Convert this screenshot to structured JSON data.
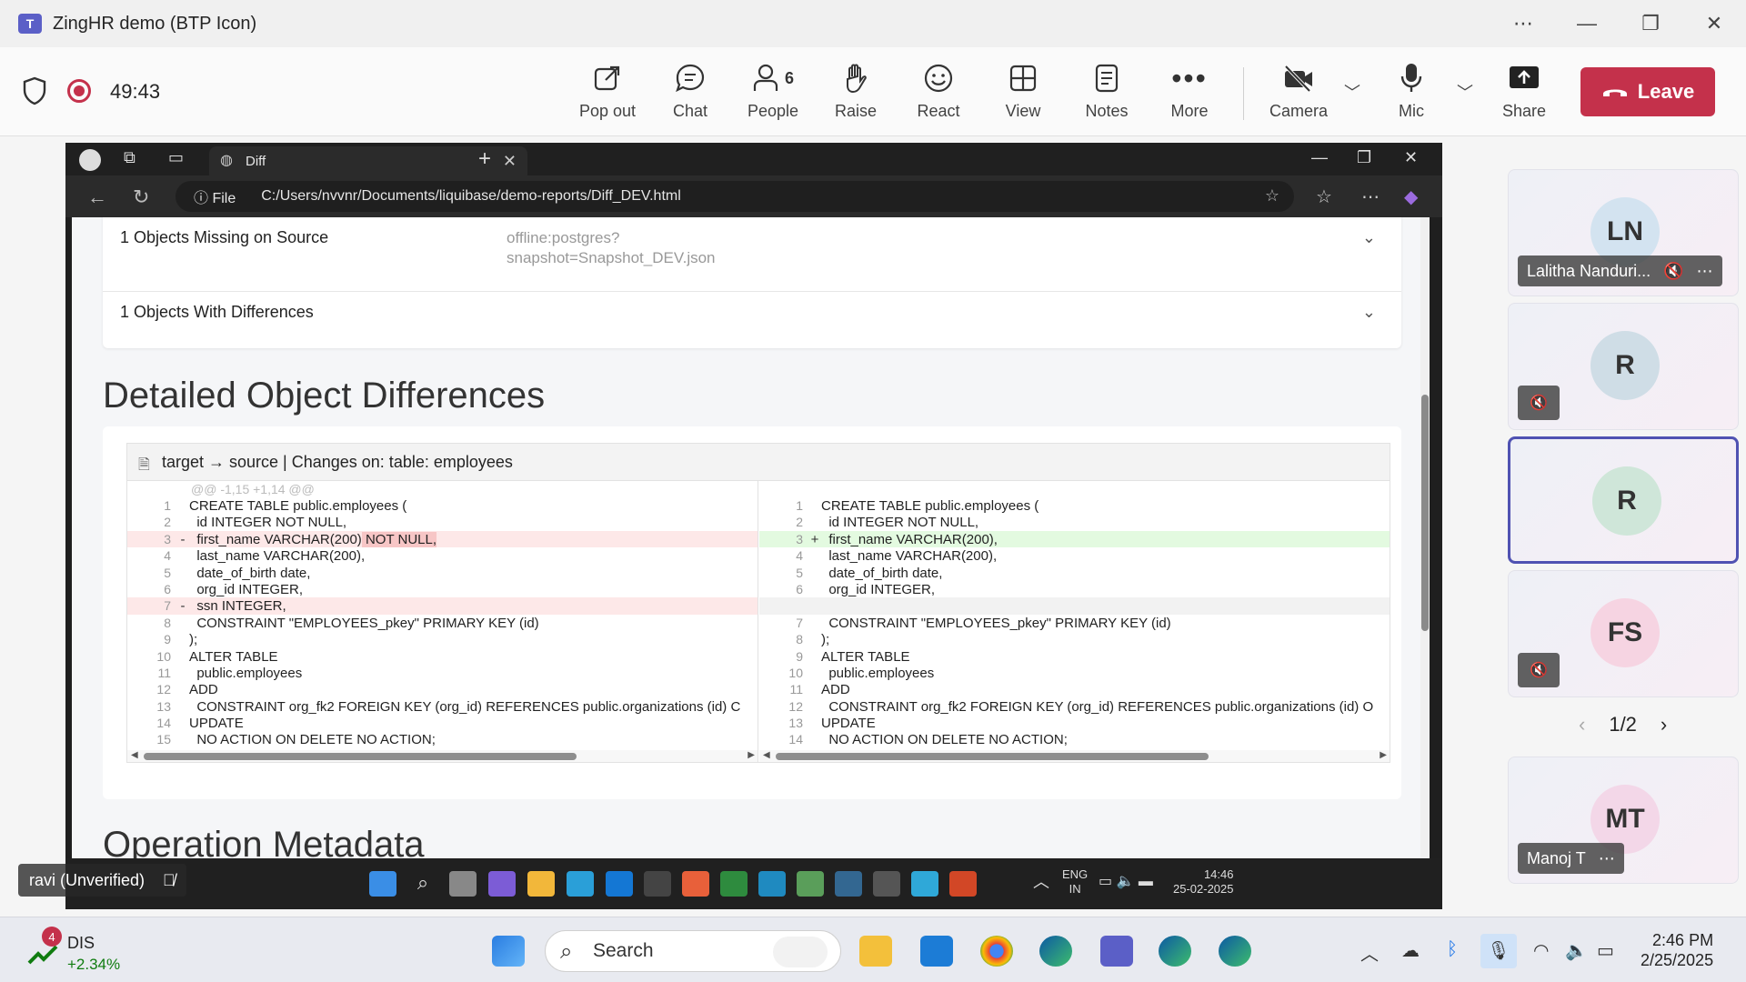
{
  "window": {
    "title": "ZingHR demo (BTP Icon)"
  },
  "meeting": {
    "timer": "49:43",
    "buttons": [
      {
        "label": "Pop out",
        "icon": "pop-out-icon"
      },
      {
        "label": "Chat",
        "icon": "chat-icon"
      },
      {
        "label": "People",
        "icon": "people-icon",
        "count": "6"
      },
      {
        "label": "Raise",
        "icon": "raise-hand-icon"
      },
      {
        "label": "React",
        "icon": "react-icon"
      },
      {
        "label": "View",
        "icon": "view-icon"
      },
      {
        "label": "Notes",
        "icon": "notes-icon"
      },
      {
        "label": "More",
        "icon": "more-icon"
      }
    ],
    "camera_label": "Camera",
    "mic_label": "Mic",
    "share_label": "Share",
    "leave_label": "Leave",
    "leave_color": "#c4314b"
  },
  "browser": {
    "tab_title": "Diff",
    "address_prefix": "File",
    "url": "C:/Users/nvvnr/Documents/liquibase/demo-reports/Diff_DEV.html"
  },
  "report": {
    "missing_on_source": "1 Objects Missing on Source",
    "offline_info_1": "offline:postgres?",
    "offline_info_2": "snapshot=Snapshot_DEV.json",
    "with_differences": "1 Objects With Differences",
    "detailed_title": "Detailed Object Differences",
    "diff_header": "target → source | Changes on: table: employees",
    "hunk": "@@ -1,15 +1,14 @@",
    "left_lines": [
      {
        "n": "1",
        "m": "",
        "t": "CREATE TABLE public.employees (",
        "type": "ctx"
      },
      {
        "n": "2",
        "m": "",
        "t": "  id INTEGER NOT NULL,",
        "type": "ctx"
      },
      {
        "n": "3",
        "m": "-",
        "t": "  first_name VARCHAR(200)",
        "hl": " NOT NULL,",
        "type": "del"
      },
      {
        "n": "4",
        "m": "",
        "t": "  last_name VARCHAR(200),",
        "type": "ctx"
      },
      {
        "n": "5",
        "m": "",
        "t": "  date_of_birth date,",
        "type": "ctx"
      },
      {
        "n": "6",
        "m": "",
        "t": "  org_id INTEGER,",
        "type": "ctx"
      },
      {
        "n": "7",
        "m": "-",
        "t": "  ssn INTEGER,",
        "type": "del"
      },
      {
        "n": "8",
        "m": "",
        "t": "  CONSTRAINT \"EMPLOYEES_pkey\" PRIMARY KEY (id)",
        "type": "ctx"
      },
      {
        "n": "9",
        "m": "",
        "t": ");",
        "type": "ctx"
      },
      {
        "n": "10",
        "m": "",
        "t": "ALTER TABLE",
        "type": "ctx"
      },
      {
        "n": "11",
        "m": "",
        "t": "  public.employees",
        "type": "ctx"
      },
      {
        "n": "12",
        "m": "",
        "t": "ADD",
        "type": "ctx"
      },
      {
        "n": "13",
        "m": "",
        "t": "  CONSTRAINT org_fk2 FOREIGN KEY (org_id) REFERENCES public.organizations (id) C",
        "type": "ctx"
      },
      {
        "n": "14",
        "m": "",
        "t": "UPDATE",
        "type": "ctx"
      },
      {
        "n": "15",
        "m": "",
        "t": "  NO ACTION ON DELETE NO ACTION;",
        "type": "ctx"
      }
    ],
    "right_lines": [
      {
        "n": "1",
        "m": "",
        "t": "CREATE TABLE public.employees (",
        "type": "ctx"
      },
      {
        "n": "2",
        "m": "",
        "t": "  id INTEGER NOT NULL,",
        "type": "ctx"
      },
      {
        "n": "3",
        "m": "+",
        "t": "  first_name VARCHAR(200),",
        "type": "add"
      },
      {
        "n": "4",
        "m": "",
        "t": "  last_name VARCHAR(200),",
        "type": "ctx"
      },
      {
        "n": "5",
        "m": "",
        "t": "  date_of_birth date,",
        "type": "ctx"
      },
      {
        "n": "6",
        "m": "",
        "t": "  org_id INTEGER,",
        "type": "ctx"
      },
      {
        "n": "",
        "m": "",
        "t": "",
        "type": "empty"
      },
      {
        "n": "7",
        "m": "",
        "t": "  CONSTRAINT \"EMPLOYEES_pkey\" PRIMARY KEY (id)",
        "type": "ctx"
      },
      {
        "n": "8",
        "m": "",
        "t": ");",
        "type": "ctx"
      },
      {
        "n": "9",
        "m": "",
        "t": "ALTER TABLE",
        "type": "ctx"
      },
      {
        "n": "10",
        "m": "",
        "t": "  public.employees",
        "type": "ctx"
      },
      {
        "n": "11",
        "m": "",
        "t": "ADD",
        "type": "ctx"
      },
      {
        "n": "12",
        "m": "",
        "t": "  CONSTRAINT org_fk2 FOREIGN KEY (org_id) REFERENCES public.organizations (id) O",
        "type": "ctx"
      },
      {
        "n": "13",
        "m": "",
        "t": "UPDATE",
        "type": "ctx"
      },
      {
        "n": "14",
        "m": "",
        "t": "  NO ACTION ON DELETE NO ACTION;",
        "type": "ctx"
      }
    ],
    "operation_title": "Operation Metadata"
  },
  "inner_taskbar": {
    "lang": "ENG",
    "region": "IN",
    "time": "14:46",
    "date": "25-02-2025"
  },
  "presenter_tag": "ravi (Unverified)",
  "participants": [
    {
      "initials": "LN",
      "name": "Lalitha Nanduri...",
      "avatar_color": "#d3e3f0",
      "text_color": "#333"
    },
    {
      "initials": "R",
      "name": "",
      "avatar_color": "#cfdde6",
      "text_color": "#333"
    },
    {
      "initials": "R",
      "name": "",
      "avatar_color": "#cfe6d9",
      "text_color": "#333",
      "active": true
    },
    {
      "initials": "FS",
      "name": "",
      "avatar_color": "#f6d4e2",
      "text_color": "#333"
    },
    {
      "initials": "MT",
      "name": "Manoj T",
      "avatar_color": "#f3d7e8",
      "text_color": "#333"
    }
  ],
  "pager": "1/2",
  "taskbar": {
    "stock_badge": "4",
    "stock_name": "DIS",
    "stock_change": "+2.34%",
    "search_label": "Search",
    "time": "2:46 PM",
    "date": "2/25/2025"
  }
}
